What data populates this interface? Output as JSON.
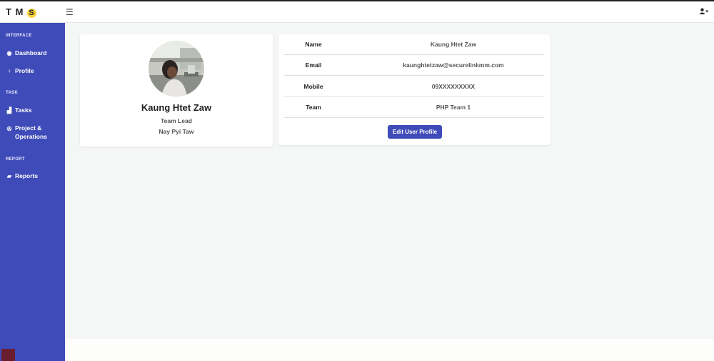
{
  "app": {
    "logo": {
      "t": "T",
      "m": "M",
      "s": "S"
    }
  },
  "sidebar": {
    "sections": [
      {
        "heading": "INTERFACE"
      },
      {
        "heading": "TASK"
      },
      {
        "heading": "REPORT"
      }
    ],
    "items": [
      {
        "label": "Dashboard",
        "icon": "dashboard-icon"
      },
      {
        "label": "Profile",
        "icon": "user-icon"
      },
      {
        "label": "Tasks",
        "icon": "chart-icon"
      },
      {
        "label": "Project &",
        "label2": "Operations",
        "icon": "project-icon"
      },
      {
        "label": "Reports",
        "icon": "folder-icon"
      }
    ]
  },
  "header": {
    "menu_icon": "hamburger-icon",
    "user_icon": "user-dropdown-icon"
  },
  "profile": {
    "name": "Kaung Htet Zaw",
    "role": "Team Lead",
    "location": "Nay Pyi Taw"
  },
  "details": {
    "rows": [
      {
        "label": "Name",
        "value": "Kaung Htet Zaw"
      },
      {
        "label": "Email",
        "value": "kaunghtetzaw@securelinkmm.com"
      },
      {
        "label": "Mobile",
        "value": "09XXXXXXXXX"
      },
      {
        "label": "Team",
        "value": "PHP Team 1"
      }
    ],
    "edit_button": "Edit User Profile"
  },
  "colors": {
    "sidebar_bg": "#3f4bb8",
    "accent": "#3f4bb8",
    "page_bg": "#f5f6f6"
  }
}
